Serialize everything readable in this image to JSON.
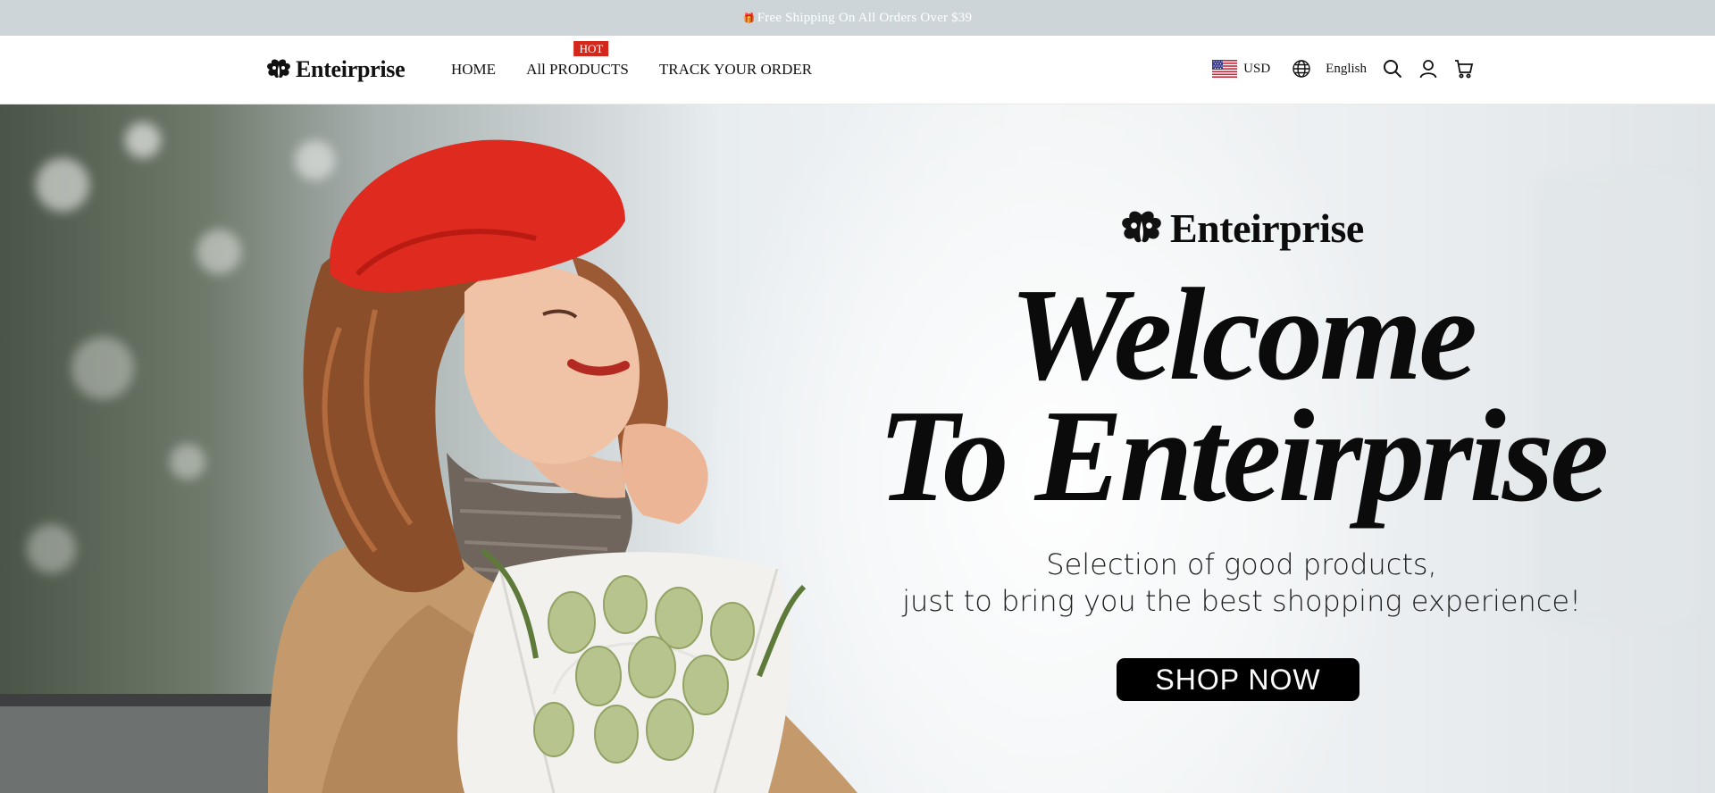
{
  "announcement": {
    "text": "Free Shipping On All Orders Over $39",
    "gift_glyph": "🎁"
  },
  "brand": {
    "name": "Enteirprise",
    "logo_icon": "clover-icon"
  },
  "nav": {
    "items": [
      {
        "label": "HOME"
      },
      {
        "label": "All PRODUCTS",
        "badge": "HOT"
      },
      {
        "label": "TRACK YOUR ORDER"
      }
    ]
  },
  "header_right": {
    "currency": "USD",
    "currency_flag": "us-flag-icon",
    "language": "English",
    "icons": [
      "globe-icon",
      "search-icon",
      "user-icon",
      "cart-icon"
    ]
  },
  "hero": {
    "logo_text": "Enteirprise",
    "heading_line1": "Welcome",
    "heading_line2": "To Enteirprise",
    "subtitle_line1": "Selection of good products,",
    "subtitle_line2": "just to bring you the best shopping experience!",
    "cta_label": "SHOP NOW"
  },
  "colors": {
    "announce_bg": "#cdd5d9",
    "hot_badge": "#d4261a",
    "cta_bg": "#000000"
  }
}
